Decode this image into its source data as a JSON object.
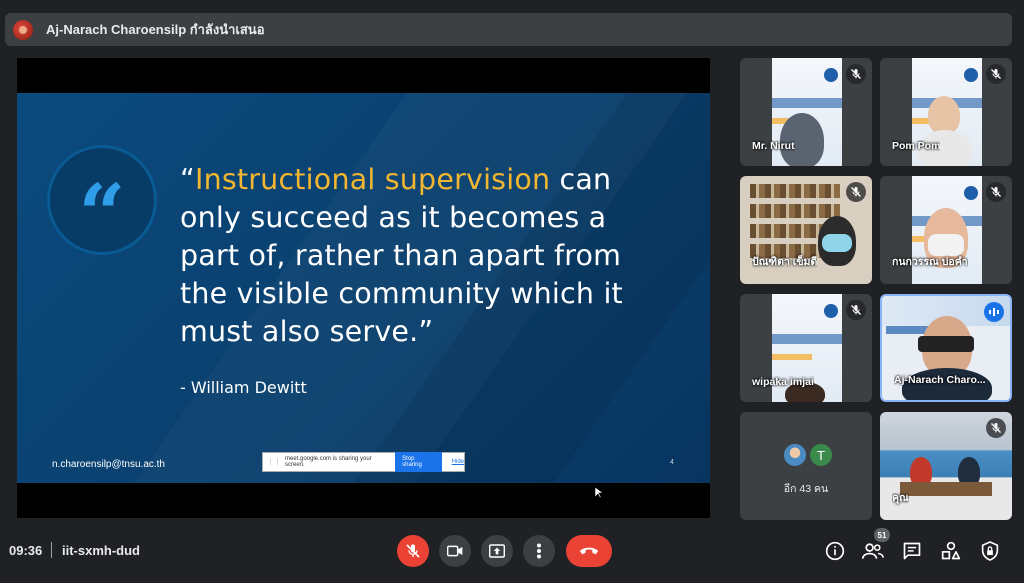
{
  "banner": {
    "presenter_text": "Aj-Narach Charoensilp กำลังนำเสนอ"
  },
  "slide": {
    "quote_mark": "“",
    "quote_open": "“",
    "quote_highlight": "Instructional supervision",
    "quote_rest": " can only succeed as it becomes a part of, rather than apart from the visible community which it must also serve.”",
    "author": "- William Dewitt",
    "email": "n.charoensilp@tnsu.ac.th",
    "page_number": "4"
  },
  "share_bar": {
    "message": "meet.google.com is sharing your screen.",
    "stop_label": "Stop sharing",
    "hide_label": "Hide"
  },
  "participants": [
    {
      "name": "Mr. Nirut",
      "muted": true
    },
    {
      "name": "Pom Pom",
      "muted": true
    },
    {
      "name": "ปัณฑิตา เข็มดี",
      "muted": true
    },
    {
      "name": "กนกวรรณ บ่อคำ",
      "muted": true
    },
    {
      "name": "wipaka imjai",
      "muted": true
    },
    {
      "name": "Aj-Narach Charo...",
      "muted": false,
      "speaking": true
    },
    {
      "name": "คุณ",
      "muted": true
    }
  ],
  "more_tile": {
    "avatar_letter": "T",
    "label": "อีก 43 คน"
  },
  "bottom_bar": {
    "time": "09:36",
    "meeting_code": "iit-sxmh-dud",
    "people_count": "51"
  },
  "colors": {
    "background": "#202124",
    "end_call": "#ea4335",
    "highlight": "#f2b630",
    "slide_blue": "#0a3f6d"
  }
}
